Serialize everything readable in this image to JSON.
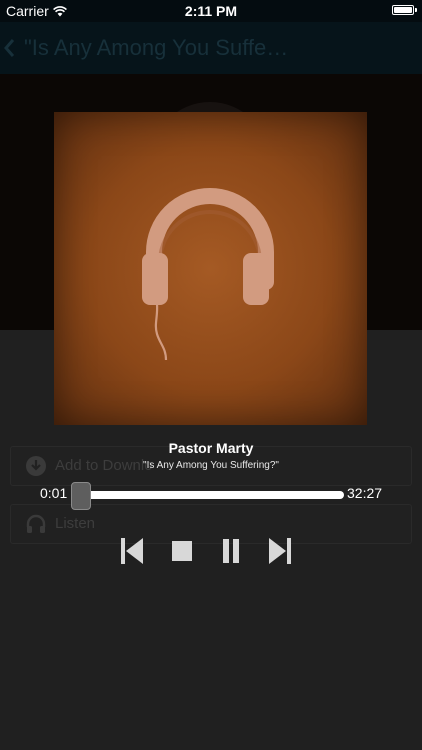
{
  "status_bar": {
    "carrier": "Carrier",
    "time": "2:11 PM",
    "wifi_icon": "wifi-icon",
    "battery_icon": "battery-icon"
  },
  "nav": {
    "back_icon": "chevron-left-icon",
    "title": "\"Is Any Among You Suffe…"
  },
  "background_list": {
    "rows": [
      {
        "icon": "download-circle-icon",
        "label": "Add to Downlo"
      },
      {
        "icon": "headphones-icon",
        "label": "Listen"
      }
    ]
  },
  "player": {
    "artwork_icon": "headphones-icon",
    "artwork_color": "#8b4718",
    "speaker": "Pastor Marty",
    "title": "\"Is Any Among You Suffering?\"",
    "elapsed": "0:01",
    "duration": "32:27",
    "progress": 0.0005,
    "controls": {
      "previous": "skip-back-icon",
      "stop": "stop-icon",
      "pause": "pause-icon",
      "next": "skip-forward-icon"
    }
  }
}
